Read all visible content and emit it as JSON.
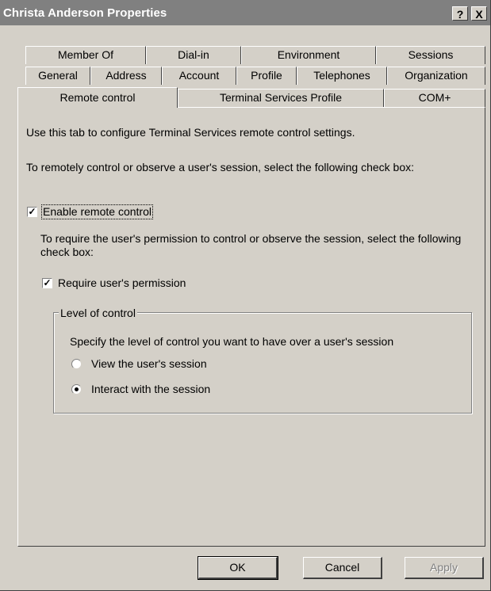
{
  "window": {
    "title": "Christa Anderson Properties",
    "help_label": "?",
    "close_label": "X"
  },
  "tabs": {
    "row1": [
      "Member Of",
      "Dial-in",
      "Environment",
      "Sessions"
    ],
    "row2": [
      "General",
      "Address",
      "Account",
      "Profile",
      "Telephones",
      "Organization"
    ],
    "row3": [
      "Remote control",
      "Terminal Services Profile",
      "COM+"
    ],
    "active": "Remote control"
  },
  "panel": {
    "intro": "Use this tab to configure Terminal Services remote control settings.",
    "instruction": "To remotely control or observe a user's session, select the following check box:",
    "enable_label": "Enable remote control",
    "enable_checked": true,
    "permission_instruction": "To require the user's permission to control or observe the session, select the following check box:",
    "permission_label": "Require user's permission",
    "permission_checked": true,
    "level_group": {
      "legend": "Level of control",
      "description": "Specify the level of control you want to have over a user's session",
      "options": [
        "View the user's session",
        "Interact with the session"
      ],
      "selected": "Interact with the session"
    }
  },
  "buttons": {
    "ok": "OK",
    "cancel": "Cancel",
    "apply": "Apply"
  },
  "colors": {
    "dialog_bg": "#d4d0c8",
    "titlebar_bg": "#808080"
  }
}
